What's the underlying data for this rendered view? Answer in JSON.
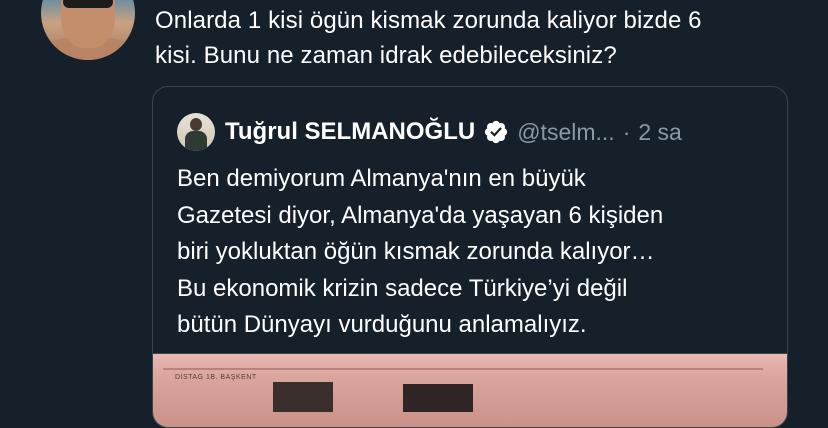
{
  "tweet": {
    "avatar_icon": "user-avatar",
    "text_line1": "Onlarda 1 kisi ögün kismak zorunda kaliyor bizde 6",
    "text_line2": "kisi. Bunu ne zaman idrak edebileceksiniz?"
  },
  "quote": {
    "avatar_icon": "quoted-user-avatar",
    "name": "Tuğrul SELMANOĞLU",
    "verified_icon": "verified-badge-icon",
    "handle": "@tselm...",
    "separator": "·",
    "time": "2 sa",
    "lines": [
      "Ben demiyorum Almanya'nın en büyük",
      "Gazetesi diyor, Almanya'da yaşayan 6 kişiden",
      "biri yokluktan öğün kısmak zorunda kalıyor…",
      "Bu ekonomik krizin sadece Türkiye’yi değil",
      "bütün Dünyayı vurduğunu anlamalıyız."
    ],
    "media_caption": "DİSTAG 1B. BAŞKENT"
  },
  "colors": {
    "background": "#15202b",
    "border": "#38444d",
    "text": "#ffffff",
    "muted": "#8b98a5"
  }
}
